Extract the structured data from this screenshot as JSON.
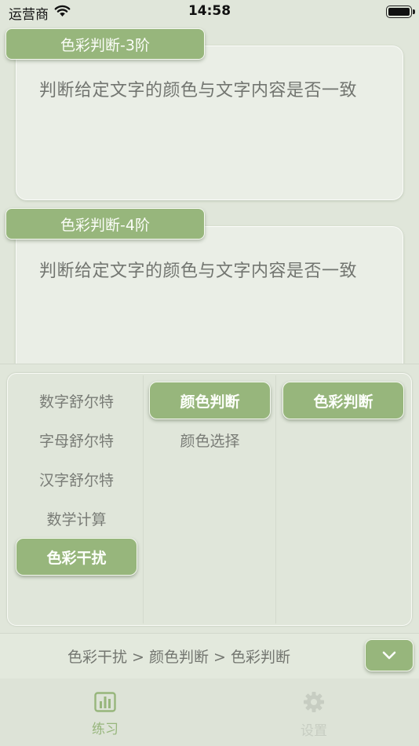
{
  "status_bar": {
    "carrier": "运营商",
    "time": "14:58"
  },
  "cards": [
    {
      "tag": "色彩判断-3阶",
      "description": "判断给定文字的颜色与文字内容是否一致"
    },
    {
      "tag": "色彩判断-4阶",
      "description": "判断给定文字的颜色与文字内容是否一致"
    }
  ],
  "picker": {
    "categories": [
      "数字舒尔特",
      "字母舒尔特",
      "汉字舒尔特",
      "数学计算",
      "色彩干扰"
    ],
    "selected_category": "色彩干扰",
    "subcategories": [
      "颜色判断",
      "颜色选择"
    ],
    "selected_subcategory": "颜色判断",
    "modes": [
      "色彩判断"
    ],
    "selected_mode": "色彩判断"
  },
  "breadcrumb": "色彩干扰 > 颜色判断 > 色彩判断",
  "tabs": [
    {
      "label": "练习",
      "icon": "bar-chart-icon",
      "active": true
    },
    {
      "label": "设置",
      "icon": "gear-icon",
      "active": false
    }
  ],
  "colors": {
    "accent": "#97b67c",
    "background": "#e0e6da",
    "card": "#eaeee6",
    "inactive": "#c7cdc2"
  }
}
